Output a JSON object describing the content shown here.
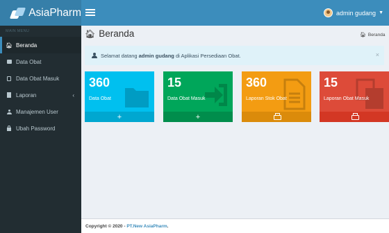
{
  "app": {
    "name": "AsiaPharm"
  },
  "user": {
    "name": "admin gudang"
  },
  "sidebar": {
    "header": "MAIN MENU",
    "items": [
      {
        "label": "Beranda",
        "icon": "home-icon",
        "active": true
      },
      {
        "label": "Data Obat",
        "icon": "folder-icon"
      },
      {
        "label": "Data Obat Masuk",
        "icon": "copy-icon"
      },
      {
        "label": "Laporan",
        "icon": "file-icon",
        "has_submenu": true
      },
      {
        "label": "Manajemen User",
        "icon": "user-icon"
      },
      {
        "label": "Ubah Password",
        "icon": "lock-icon"
      }
    ]
  },
  "page": {
    "title": "Beranda",
    "breadcrumb": "Beranda"
  },
  "alert": {
    "prefix": "Selamat datang ",
    "user": "admin gudang",
    "suffix": " di Aplikasi Persediaan Obat.",
    "close": "×"
  },
  "boxes": [
    {
      "number": "360",
      "label": "Data Obat",
      "footer_icon": "plus-icon",
      "color": "#00c0ef"
    },
    {
      "number": "15",
      "label": "Data Obat Masuk",
      "footer_icon": "plus-icon",
      "color": "#00a65a"
    },
    {
      "number": "360",
      "label": "Laporan Stok Obat",
      "footer_icon": "print-icon",
      "color": "#f39c12"
    },
    {
      "number": "15",
      "label": "Laporan Obat Masuk",
      "footer_icon": "print-icon",
      "color": "#dd4b39"
    }
  ],
  "footer": {
    "copyright": "Copyright © 2020 - ",
    "company": "PT.New AsiaPharm",
    "end": "."
  }
}
